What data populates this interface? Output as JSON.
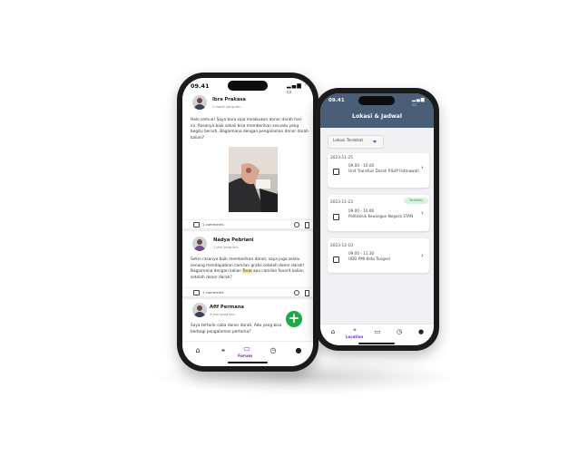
{
  "colors": {
    "accent": "#7b2bc8",
    "header": "#4a5e78",
    "fab": "#22a845",
    "badge_bg": "#d9f3df",
    "badge_text": "#2f8f47"
  },
  "forum_phone": {
    "status_time": "09.41",
    "posts": [
      {
        "author": "Ibra Prakasa",
        "time": "2 menit yang lalu",
        "text": "Halo semua! Saya baru saja melakukan donor darah hari ini. Rasanya baik sekali bisa memberikan sesuatu yang begitu berarti. Bagaimana dengan pengalaman donor darah kalian?",
        "comments": "1 comments"
      },
      {
        "author": "Nadya Pebriani",
        "time": "1 jam yang lalu",
        "text_before": "Sekin rasanya baik memberikan darah, saya juga selalu senang mendapatkan camilan gratis setelah donor darah! Bagaimana dengan kalian ",
        "text_highlight": "Teral",
        "text_after": " apa camilan favorit kalian setelah donor darah?",
        "comments": "1 comments"
      },
      {
        "author": "Afif Permana",
        "time": "3 jam yang lalu",
        "text": "Saya tertarik coba donor darah. Ada yang bisa berbagi pengalaman pertama?"
      }
    ],
    "fab_label": "+",
    "nav": {
      "items": [
        "home-icon",
        "location-icon",
        "forum-icon",
        "history-icon",
        "profile-icon"
      ],
      "active_label": "Forum"
    }
  },
  "schedule_phone": {
    "status_time": "09.41",
    "title": "Lokasi & Jadwal",
    "filter": {
      "selected": "Lokasi Terdekat"
    },
    "schedules": [
      {
        "date": "2023-11-25",
        "time": "09.00 - 10.00",
        "place": "Unit Transfusi Darah RSUP Fatmawati",
        "badge": ""
      },
      {
        "date": "2023-11-23",
        "time": "09.00 - 10.00",
        "place": "Politeknik Keuangan Negara STAN",
        "badge": "Terdaftar"
      },
      {
        "date": "2023-12-10",
        "time": "09.00 - 11.30",
        "place": "UDD PMI Kota Tangsel",
        "badge": ""
      }
    ],
    "nav": {
      "items": [
        "home-icon",
        "location-icon",
        "forum-icon",
        "history-icon",
        "profile-icon"
      ],
      "active_label": "Location"
    }
  }
}
